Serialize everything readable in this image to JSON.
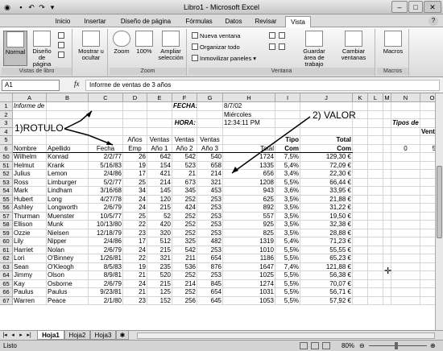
{
  "window": {
    "title": "Libro1 - Microsoft Excel"
  },
  "tabs": [
    "Inicio",
    "Insertar",
    "Diseño de página",
    "Fórmulas",
    "Datos",
    "Revisar",
    "Vista"
  ],
  "active_tab": "Vista",
  "ribbon": {
    "vistas_libro": {
      "label": "Vistas de libro",
      "normal": "Normal",
      "diseno": "Diseño de página"
    },
    "mostrar": {
      "label": "Mostrar u ocultar"
    },
    "zoom": {
      "label": "Zoom",
      "zoom_btn": "Zoom",
      "pct": "100%",
      "ampliar": "Ampliar selección"
    },
    "ventana": {
      "label": "Ventana",
      "nueva": "Nueva ventana",
      "organizar": "Organizar todo",
      "inmovilizar": "Inmovilizar paneles",
      "guardar": "Guardar área de trabajo",
      "cambiar": "Cambiar ventanas"
    },
    "macros": {
      "label": "Macros",
      "btn": "Macros"
    }
  },
  "formula_bar": {
    "cell_ref": "A1",
    "fx": "fx",
    "content": "Informe de ventas de 3 años"
  },
  "columns": [
    "A",
    "B",
    "C",
    "D",
    "E",
    "F",
    "G",
    "H",
    "I",
    "J",
    "K",
    "L",
    "M",
    "N",
    "O"
  ],
  "rows": {
    "r1": {
      "num": "1",
      "A": "Informe de ventas de 3 años",
      "F": "FECHA:",
      "H": "8/7/02"
    },
    "r2": {
      "num": "2",
      "H": "Miércoles"
    },
    "r3": {
      "num": "3",
      "F": "HORA:",
      "H": "12:34:11 PM",
      "N": "Tipos de co"
    },
    "r4": {
      "num": "4",
      "O": "Ventas to"
    },
    "r5": {
      "num": "5",
      "D": "Años",
      "E": "Ventas",
      "F": "Ventas",
      "G": "Ventas",
      "I": "Tipo",
      "J": "Total"
    },
    "r6": {
      "num": "6",
      "A": "Nombre",
      "B": "Apellido",
      "C": "Fecha",
      "D": "Emp",
      "E": "Año 1",
      "F": "Año 2",
      "G": "Año 3",
      "H": "Total",
      "I": "Com",
      "J": "Com",
      "N": "0",
      "O": "500"
    }
  },
  "data_rows": [
    [
      "50",
      "Wilhelm",
      "Konrad",
      "2/2/77",
      "26",
      "642",
      "542",
      "540",
      "1724",
      "7,5%",
      "129,30 €"
    ],
    [
      "51",
      "Helmut",
      "Krank",
      "5/16/83",
      "19",
      "154",
      "523",
      "658",
      "1335",
      "5,4%",
      "72,09 €"
    ],
    [
      "52",
      "Julius",
      "Lemon",
      "2/4/86",
      "17",
      "421",
      "21",
      "214",
      "656",
      "3,4%",
      "22,30 €"
    ],
    [
      "53",
      "Ross",
      "Limburger",
      "5/2/77",
      "25",
      "214",
      "673",
      "321",
      "1208",
      "5,5%",
      "66,44 €"
    ],
    [
      "54",
      "Mark",
      "Lindham",
      "3/16/68",
      "34",
      "145",
      "345",
      "453",
      "943",
      "3,6%",
      "33,95 €"
    ],
    [
      "55",
      "Hubert",
      "Long",
      "4/27/78",
      "24",
      "120",
      "252",
      "253",
      "625",
      "3,5%",
      "21,88 €"
    ],
    [
      "56",
      "Ashley",
      "Longworth",
      "2/6/79",
      "24",
      "215",
      "424",
      "253",
      "892",
      "3,5%",
      "31,22 €"
    ],
    [
      "57",
      "Thurman",
      "Muenster",
      "10/5/77",
      "25",
      "52",
      "252",
      "253",
      "557",
      "3,5%",
      "19,50 €"
    ],
    [
      "58",
      "Ellison",
      "Munk",
      "10/13/80",
      "22",
      "420",
      "252",
      "253",
      "925",
      "3,5%",
      "32,38 €"
    ],
    [
      "59",
      "Ozzie",
      "Nielsen",
      "12/18/79",
      "23",
      "320",
      "252",
      "253",
      "825",
      "3,5%",
      "28,88 €"
    ],
    [
      "60",
      "Lily",
      "Nipper",
      "2/4/86",
      "17",
      "512",
      "325",
      "482",
      "1319",
      "5,4%",
      "71,23 €"
    ],
    [
      "61",
      "Harriet",
      "Nolan",
      "2/6/79",
      "24",
      "215",
      "542",
      "253",
      "1010",
      "5,5%",
      "55,55 €"
    ],
    [
      "62",
      "Lori",
      "O'Binney",
      "1/26/81",
      "22",
      "321",
      "211",
      "654",
      "1186",
      "5,5%",
      "65,23 €"
    ],
    [
      "63",
      "Sean",
      "O'Kleogh",
      "8/5/83",
      "19",
      "235",
      "536",
      "876",
      "1647",
      "7,4%",
      "121,88 €"
    ],
    [
      "64",
      "Jimmy",
      "Olson",
      "8/9/81",
      "21",
      "520",
      "252",
      "253",
      "1025",
      "5,5%",
      "56,38 €"
    ],
    [
      "65",
      "Kay",
      "Osborne",
      "2/6/79",
      "24",
      "215",
      "214",
      "845",
      "1274",
      "5,5%",
      "70,07 €"
    ],
    [
      "66",
      "Paulus",
      "Paulus",
      "9/23/81",
      "21",
      "125",
      "252",
      "654",
      "1031",
      "5,5%",
      "56,71 €"
    ],
    [
      "67",
      "Warren",
      "Peace",
      "2/1/80",
      "23",
      "152",
      "256",
      "645",
      "1053",
      "5,5%",
      "57,92 €"
    ]
  ],
  "annotations": {
    "rotulo": "1)ROTULO",
    "valor": "2) VALOR"
  },
  "sheets": [
    "Hoja1",
    "Hoja2",
    "Hoja3"
  ],
  "active_sheet": "Hoja1",
  "status": {
    "mode": "Listo",
    "zoom": "80%"
  }
}
